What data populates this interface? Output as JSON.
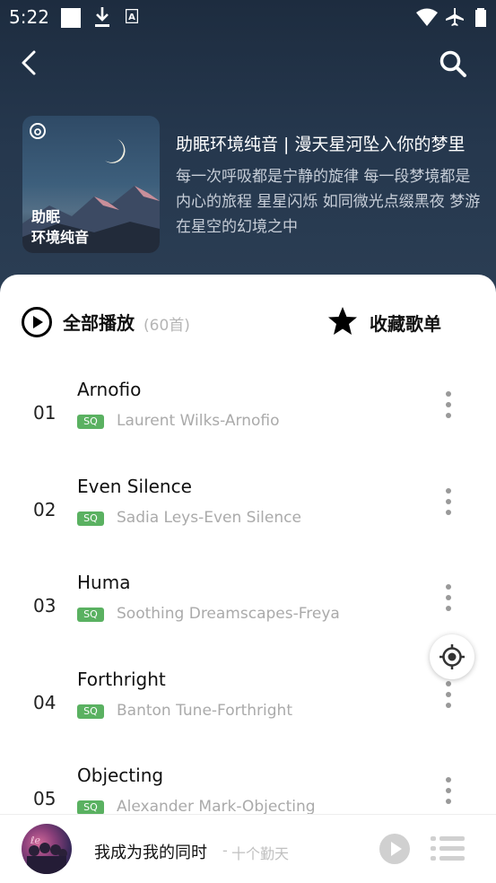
{
  "status_bar": {
    "time": "5:22"
  },
  "playlist": {
    "cover_title_line1": "助眠",
    "cover_title_line2": "环境纯音",
    "title": "助眠环境纯音 | 漫天星河坠入你的梦里",
    "description": "每一次呼吸都是宁静的旋律 每一段梦境都是内心的旅程 星星闪烁 如同微光点缀黑夜 梦游在星空的幻境之中"
  },
  "actions": {
    "play_all_label": "全部播放",
    "play_all_count": "(60首)",
    "collect_label": "收藏歌单"
  },
  "songs": [
    {
      "num": "01",
      "title": "Arnofio",
      "badge": "SQ",
      "artist": "Laurent Wilks-Arnofio"
    },
    {
      "num": "02",
      "title": "Even Silence",
      "badge": "SQ",
      "artist": "Sadia Leys-Even Silence"
    },
    {
      "num": "03",
      "title": "Huma",
      "badge": "SQ",
      "artist": "Soothing Dreamscapes-Freya"
    },
    {
      "num": "04",
      "title": "Forthright",
      "badge": "SQ",
      "artist": "Banton Tune-Forthright"
    },
    {
      "num": "05",
      "title": "Objecting",
      "badge": "SQ",
      "artist": "Alexander Mark-Objecting"
    }
  ],
  "now_playing": {
    "song": "我成为我的同时",
    "separator": "-",
    "singer": "十个勤天"
  },
  "colors": {
    "header_bg": "#25374d",
    "sq_badge": "#5ab161",
    "secondary_text": "#aaaaaa"
  },
  "icons": [
    "back-icon",
    "search-icon",
    "play-circle-icon",
    "star-icon",
    "more-vertical-icon",
    "locate-icon",
    "play-icon",
    "playlist-icon"
  ]
}
